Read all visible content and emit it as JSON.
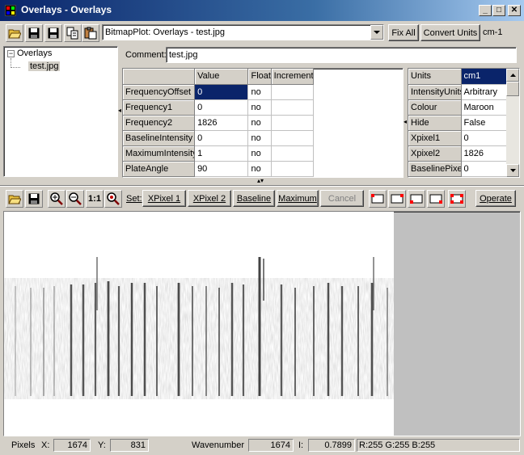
{
  "window": {
    "title": "Overlays - Overlays"
  },
  "toolbar": {
    "plot_select": "BitmapPlot: Overlays - test.jpg",
    "fix_all": "Fix All",
    "convert_units": "Convert Units",
    "units_label": "cm-1"
  },
  "tree": {
    "root": "Overlays",
    "child": "test.jpg"
  },
  "comment": {
    "label": "Comment:",
    "value": "test.jpg"
  },
  "params": {
    "headers": [
      "Value",
      "Float",
      "Increment"
    ],
    "rows": [
      {
        "name": "FrequencyOffset",
        "value": "0",
        "float": "no",
        "increment": ""
      },
      {
        "name": "Frequency1",
        "value": "0",
        "float": "no",
        "increment": ""
      },
      {
        "name": "Frequency2",
        "value": "1826",
        "float": "no",
        "increment": ""
      },
      {
        "name": "BaselineIntensity",
        "value": "0",
        "float": "no",
        "increment": ""
      },
      {
        "name": "MaximumIntensity",
        "value": "1",
        "float": "no",
        "increment": ""
      },
      {
        "name": "PlateAngle",
        "value": "90",
        "float": "no",
        "increment": ""
      }
    ]
  },
  "props": {
    "rows": [
      {
        "name": "Units",
        "value": "cm1"
      },
      {
        "name": "IntensityUnits",
        "value": "Arbitrary"
      },
      {
        "name": "Colour",
        "value": "Maroon"
      },
      {
        "name": "Hide",
        "value": "False"
      },
      {
        "name": "Xpixel1",
        "value": "0"
      },
      {
        "name": "Xpixel2",
        "value": "1826"
      },
      {
        "name": "BaselinePixel",
        "value": "0"
      }
    ]
  },
  "plot_toolbar": {
    "zoom_one": "1:1",
    "set_label": "Set:",
    "xpixel1": "XPixel 1",
    "xpixel2": "XPixel 2",
    "baseline": "Baseline",
    "maximum": "Maximum",
    "cancel": "Cancel",
    "operate": "Operate"
  },
  "status": {
    "pixels_label": "Pixels",
    "x_label": "X:",
    "x_value": "1674",
    "y_label": "Y:",
    "y_value": "831",
    "wavenumber_label": "Wavenumber",
    "wavenumber_value": "1674",
    "i_label": "I:",
    "i_value": "0.7899",
    "rgb": "R:255 G:255 B:255"
  },
  "colors": {
    "title_bar": "#0a246a",
    "selection": "#0a246a",
    "marker_red": "#ff0000",
    "face": "#d4d0c8"
  },
  "icons": [
    "open-folder-icon",
    "save-icon",
    "save-all-icon",
    "copy-icon",
    "paste-icon",
    "zoom-in-icon",
    "zoom-out-icon",
    "zoom-fit-icon"
  ]
}
